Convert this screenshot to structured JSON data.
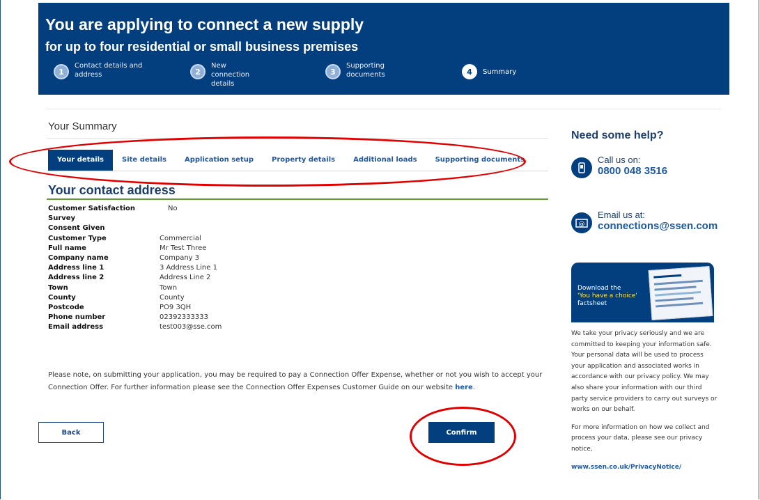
{
  "banner": {
    "title": "You are applying to connect a new supply",
    "subtitle": "for up to four residential or small business premises",
    "steps": [
      {
        "num": "1",
        "label": "Contact details and address"
      },
      {
        "num": "2",
        "label": "New connection details"
      },
      {
        "num": "3",
        "label": "Supporting documents"
      },
      {
        "num": "4",
        "label": "Summary"
      }
    ]
  },
  "summary_title": "Your Summary",
  "tabs": [
    "Your details",
    "Site details",
    "Application setup",
    "Property details",
    "Additional loads",
    "Supporting documents"
  ],
  "section_title": "Your contact address",
  "details": [
    {
      "k": "Customer Satisfaction Survey",
      "v": "No"
    },
    {
      "k": "Consent Given",
      "v": ""
    },
    {
      "k": "Customer Type",
      "v": "Commercial"
    },
    {
      "k": "Full name",
      "v": "Mr Test Three"
    },
    {
      "k": "Company name",
      "v": "Company 3"
    },
    {
      "k": "Address line 1",
      "v": "3 Address Line 1"
    },
    {
      "k": "Address line 2",
      "v": "Address Line 2"
    },
    {
      "k": "Town",
      "v": "Town"
    },
    {
      "k": "County",
      "v": "County"
    },
    {
      "k": "Postcode",
      "v": "PO9 3QH"
    },
    {
      "k": "Phone number",
      "v": "02392333333"
    },
    {
      "k": "Email address",
      "v": "test003@sse.com"
    }
  ],
  "note": {
    "text": "Please note, on submitting your application, you may be required to pay a Connection Offer Expense, whether or not you wish to accept your Connection Offer. For further information please see the Connection Offer Expenses Customer Guide on our website ",
    "link": "here",
    "end": "."
  },
  "buttons": {
    "back": "Back",
    "confirm": "Confirm"
  },
  "help": {
    "title": "Need some help?",
    "call_label": "Call us on:",
    "call_value": "0800 048 3516",
    "email_label": "Email us at:",
    "email_value": "connections@ssen.com"
  },
  "factsheet": {
    "line1": "Download the",
    "line2": "'You have a choice'",
    "line3": "factsheet"
  },
  "privacy": {
    "p1": "We take your privacy seriously and we are committed to keeping your information safe. Your personal data will be used to process your application and associated works in accordance with our privacy policy. We may also share your information with our third party service providers to carry out surveys or works on our behalf.",
    "p2": "For more information on how we collect and process your data, please see our privacy notice,",
    "link": "www.ssen.co.uk/PrivacyNotice/"
  },
  "colors": {
    "brand": "#033f7f",
    "link": "#1f5aa6",
    "highlight": "#e00000",
    "accent_line": "#5aa02c"
  }
}
